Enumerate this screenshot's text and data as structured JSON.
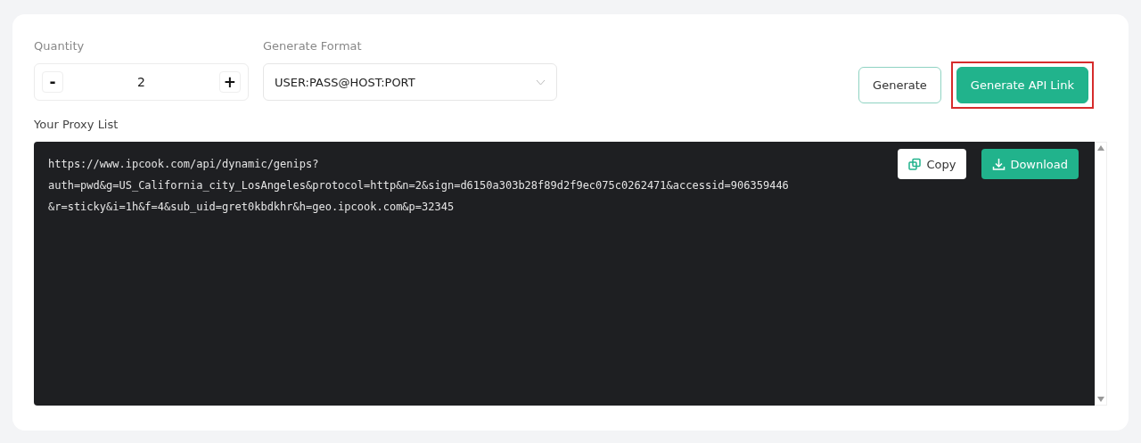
{
  "quantity": {
    "label": "Quantity",
    "decrement": "-",
    "value": "2",
    "increment": "+"
  },
  "format": {
    "label": "Generate Format",
    "value": "USER:PASS@HOST:PORT"
  },
  "actions": [
    {
      "label": "Generate",
      "kind": "outline",
      "highlighted": false
    },
    {
      "label": "Generate API Link",
      "kind": "primary",
      "highlighted": true
    }
  ],
  "proxy_list": {
    "label": "Your Proxy List",
    "lines": [
      "https://www.ipcook.com/api/dynamic/genips?",
      "auth=pwd&g=US_California_city_LosAngeles&protocol=http&n=2&sign=d6150a303b28f89d2f9ec075c0262471&accessid=906359446",
      "&r=sticky&i=1h&f=4&sub_uid=gret0kbdkhr&h=geo.ipcook.com&p=32345"
    ],
    "copy": "Copy",
    "download": "Download"
  }
}
